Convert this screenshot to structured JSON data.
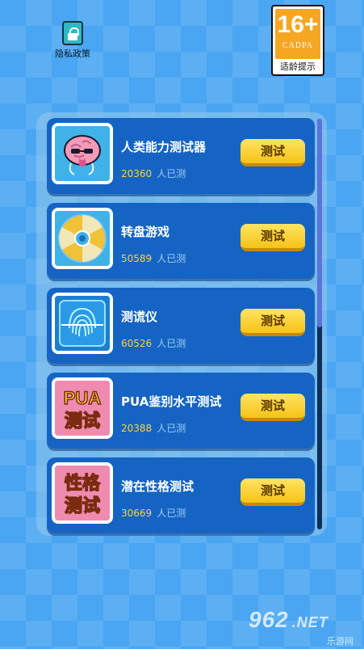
{
  "privacy": {
    "label": "隐私政策",
    "icon": "privacy-lock-icon"
  },
  "age_badge": {
    "rating": "16+",
    "org": "CADPA",
    "caption": "适龄提示"
  },
  "tests": [
    {
      "title": "人类能力测试器",
      "count": "20360",
      "suffix": "人已测",
      "button": "测试",
      "icon": "brain-icon"
    },
    {
      "title": "转盘游戏",
      "count": "50589",
      "suffix": "人已测",
      "button": "测试",
      "icon": "wheel-icon"
    },
    {
      "title": "测谎仪",
      "count": "60526",
      "suffix": "人已测",
      "button": "测试",
      "icon": "fingerprint-icon"
    },
    {
      "title": "PUA鉴别水平测试",
      "count": "20388",
      "suffix": "人已测",
      "button": "测试",
      "icon": "pua-tile-icon",
      "thumb_text": [
        "PUA",
        "测试"
      ]
    },
    {
      "title": "潜在性格测试",
      "count": "30669",
      "suffix": "人已测",
      "button": "测试",
      "icon": "personality-tile-icon",
      "thumb_text": [
        "性格",
        "测试"
      ]
    }
  ],
  "watermark": {
    "brand": "962",
    "tld": ".NET",
    "name": "乐游网"
  },
  "colors": {
    "background": "#4aa6f2",
    "card": "#1564c4",
    "button": "#f6c316",
    "count": "#ffd23f",
    "badge": "#f5a623"
  }
}
